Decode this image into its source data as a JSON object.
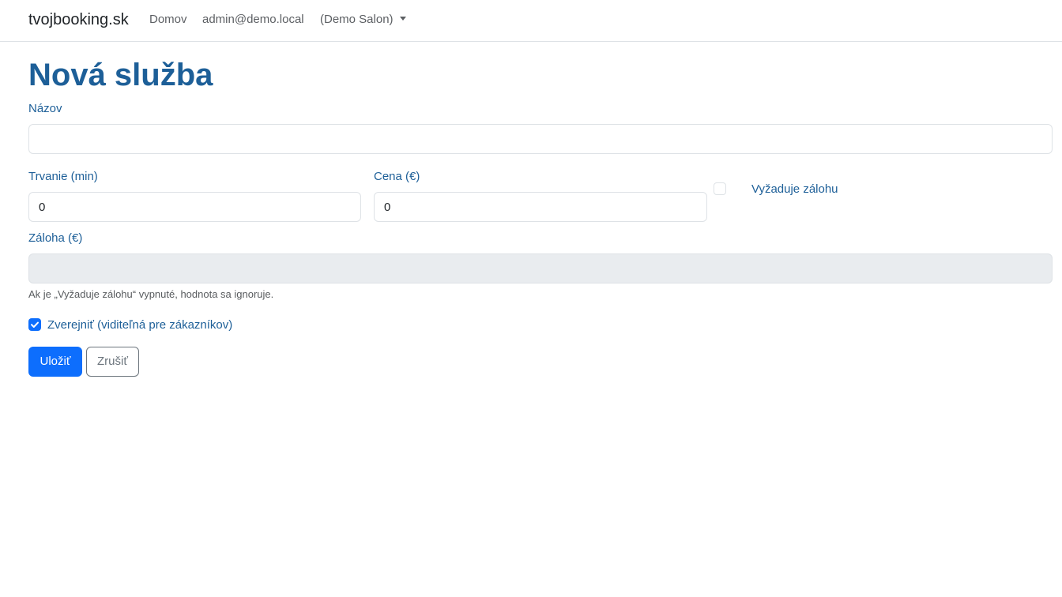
{
  "navbar": {
    "brand": "tvojbooking.sk",
    "home": "Domov",
    "user": "admin@demo.local",
    "salon": "(Demo Salon)"
  },
  "page": {
    "title": "Nová služba"
  },
  "form": {
    "name_label": "Názov",
    "name_value": "",
    "duration_label": "Trvanie (min)",
    "duration_value": "0",
    "price_label": "Cena (€)",
    "price_value": "0",
    "deposit_required_label": "Vyžaduje zálohu",
    "deposit_required_checked": false,
    "deposit_label": "Záloha (€)",
    "deposit_value": "",
    "deposit_help": "Ak je „Vyžaduje zálohu“ vypnuté, hodnota sa ignoruje.",
    "publish_label": "Zverejniť (viditeľná pre zákazníkov)",
    "publish_checked": true
  },
  "actions": {
    "save": "Uložiť",
    "cancel": "Zrušiť"
  },
  "colors": {
    "primary": "#0d6efd",
    "label": "#1d5f98",
    "border": "#dee2e6",
    "disabled_bg": "#e9ecef"
  }
}
